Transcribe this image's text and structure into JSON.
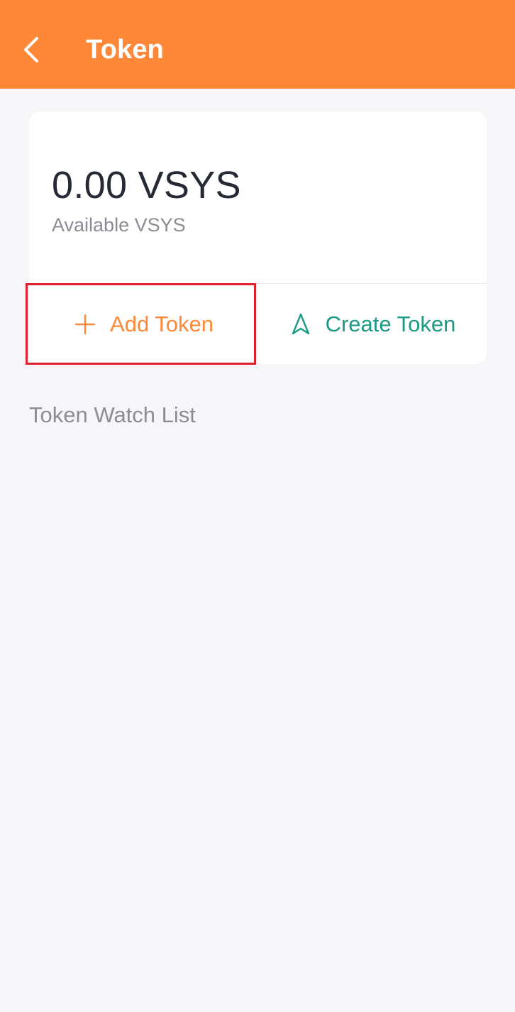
{
  "header": {
    "title": "Token",
    "back_icon": "chevron-left-icon"
  },
  "balance": {
    "amount": "0.00 VSYS",
    "label": "Available VSYS"
  },
  "actions": {
    "add_token": {
      "label": "Add Token",
      "icon": "plus-icon",
      "color": "#ff8838"
    },
    "create_token": {
      "label": "Create Token",
      "icon": "navigation-arrow-icon",
      "color": "#1b9a83"
    }
  },
  "watch_list": {
    "title": "Token Watch List"
  },
  "colors": {
    "header_bg": "#ff8838",
    "highlight": "#e1202e",
    "page_bg": "#f6f6f8"
  }
}
